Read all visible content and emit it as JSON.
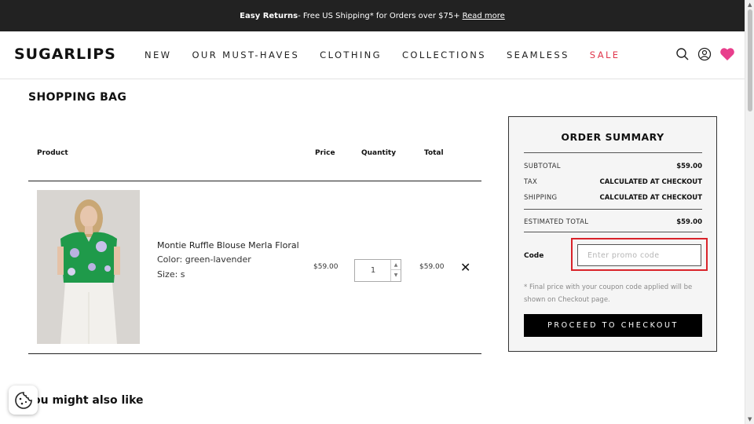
{
  "announcement": {
    "bold": "Easy Returns",
    "text": " - Free US Shipping* for Orders over $75+ ",
    "link": "Read more"
  },
  "header": {
    "logo": "SUGARLIPS",
    "nav": [
      "NEW",
      "OUR MUST-HAVES",
      "CLOTHING",
      "COLLECTIONS",
      "SEAMLESS",
      "SALE"
    ],
    "icons": [
      "search-icon",
      "account-icon",
      "heart-icon"
    ],
    "accent_color": "#e0364c",
    "heart_color": "#e83e8c"
  },
  "cart": {
    "title": "SHOPPING BAG",
    "columns": {
      "product": "Product",
      "price": "Price",
      "quantity": "Quantity",
      "total": "Total"
    },
    "item": {
      "name": "Montie Ruffle Blouse Merla Floral",
      "color": "Color: green-lavender",
      "size": "Size: s",
      "price": "$59.00",
      "quantity": "1",
      "total": "$59.00"
    }
  },
  "summary": {
    "title": "ORDER SUMMARY",
    "subtotal_label": "SUBTOTAL",
    "subtotal": "$59.00",
    "tax_label": "TAX",
    "tax": "CALCULATED AT CHECKOUT",
    "shipping_label": "SHIPPING",
    "shipping": "CALCULATED AT CHECKOUT",
    "estimated_label": "ESTIMATED TOTAL",
    "estimated": "$59.00",
    "code_label": "Code",
    "promo_placeholder": "Enter promo code",
    "note": "* Final price with your coupon code applied will be shown on Checkout page.",
    "checkout_label": "PROCEED TO CHECKOUT",
    "highlight_color": "#d9232a"
  },
  "recommendations": {
    "title": "ou might also like"
  }
}
